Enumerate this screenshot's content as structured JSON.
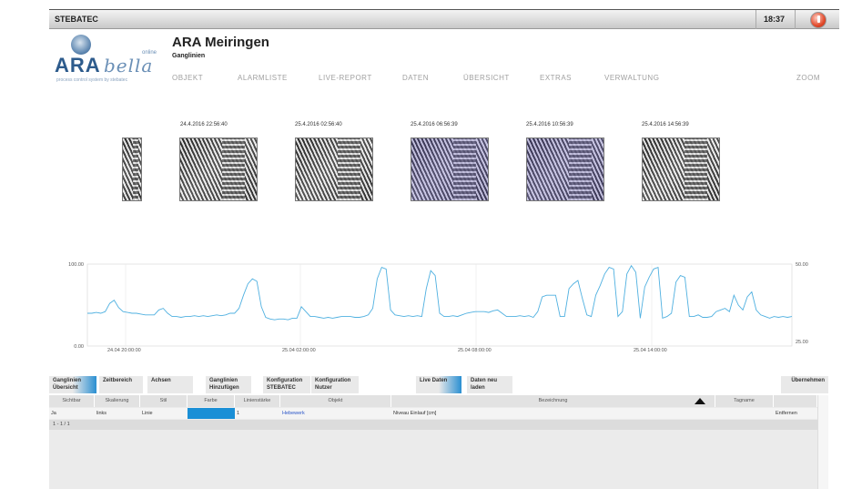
{
  "app": {
    "brand": "STEBATEC",
    "time": "18:37"
  },
  "header": {
    "logo_text": "ARA",
    "logo_text2": "bella",
    "logo_online": "online",
    "logo_tagline": "process control system by stebatec",
    "title": "ARA Meiringen",
    "subtitle": "Ganglinien"
  },
  "nav": {
    "items": [
      "OBJEKT",
      "ALARMLISTE",
      "LIVE-REPORT",
      "DATEN",
      "ÜBERSICHT",
      "EXTRAS",
      "VERWALTUNG"
    ],
    "zoom": "ZOOM"
  },
  "cameras": [
    {
      "timestamp": "24.4.2016 22:56:40",
      "tint": false
    },
    {
      "timestamp": "25.4.2016 02:56:40",
      "tint": false
    },
    {
      "timestamp": "25.4.2016 06:56:39",
      "tint": true
    },
    {
      "timestamp": "25.4.2016 10:56:39",
      "tint": true
    },
    {
      "timestamp": "25.4.2016 14:56:39",
      "tint": false
    }
  ],
  "chart_data": {
    "type": "line",
    "series_color": "#4fb0e0",
    "y_left_ticks": [
      "100.00",
      "0.00"
    ],
    "y_right_ticks": [
      "50.00",
      "25.00"
    ],
    "x_tick_labels": [
      "24.04 20:00:00",
      "25.04 02:00:00",
      "25.04 08:00:00",
      "25.04 14:00:00"
    ],
    "ylim": [
      0,
      100
    ],
    "grid": true,
    "values": [
      40,
      40,
      41,
      40,
      42,
      52,
      56,
      47,
      42,
      41,
      40,
      40,
      39,
      38,
      38,
      38,
      44,
      46,
      40,
      36,
      36,
      35,
      36,
      36,
      37,
      36,
      37,
      36,
      37,
      38,
      37,
      38,
      40,
      40,
      46,
      62,
      76,
      82,
      79,
      48,
      35,
      33,
      32,
      33,
      33,
      32,
      34,
      34,
      48,
      42,
      36,
      36,
      35,
      34,
      35,
      34,
      35,
      36,
      36,
      36,
      35,
      35,
      36,
      38,
      46,
      82,
      96,
      94,
      44,
      38,
      37,
      36,
      37,
      36,
      37,
      36,
      70,
      92,
      86,
      40,
      36,
      36,
      37,
      36,
      38,
      40,
      41,
      42,
      42,
      42,
      41,
      43,
      44,
      40,
      36,
      36,
      36,
      37,
      36,
      37,
      35,
      42,
      60,
      62,
      62,
      62,
      36,
      36,
      70,
      76,
      80,
      58,
      38,
      36,
      62,
      74,
      88,
      96,
      94,
      36,
      42,
      88,
      98,
      90,
      34,
      72,
      84,
      94,
      96,
      34,
      36,
      40,
      78,
      86,
      84,
      36,
      36,
      38,
      35,
      35,
      36,
      42,
      44,
      46,
      42,
      62,
      50,
      44,
      60,
      66,
      44,
      38,
      36,
      34,
      36,
      35,
      36,
      35,
      36
    ]
  },
  "toolbar": {
    "buttons": [
      {
        "label": "Ganglinien Übersicht",
        "active": true
      },
      {
        "label": "Zeitbereich",
        "active": false
      },
      {
        "label": "Achsen",
        "active": false
      },
      {
        "label": "Ganglinien Hinzufügen",
        "active": false
      },
      {
        "label": "Konfiguration STEBATEC",
        "active": false
      },
      {
        "label": "Konfiguration Nutzer",
        "active": false
      },
      {
        "label": "Live Daten",
        "active": true
      },
      {
        "label": "Daten neu laden",
        "active": false
      },
      {
        "label": "Übernehmen",
        "active": false
      }
    ]
  },
  "table": {
    "headers": [
      "Sichtbar",
      "Skalierung",
      "Stil",
      "Farbe",
      "Linienstärke",
      "Objekt",
      "Bezeichnung",
      "Tagname",
      ""
    ],
    "row": {
      "sichtbar": "Ja",
      "skalierung": "links",
      "stil": "Linie",
      "farbe": "#1a8fd6",
      "linienstaerke": "1",
      "objekt": "Hebewerk",
      "bezeichnung": "Niveau Einlauf [cm]",
      "tagname": "",
      "action": "Entfernen"
    },
    "pager": "1 - 1 / 1"
  }
}
